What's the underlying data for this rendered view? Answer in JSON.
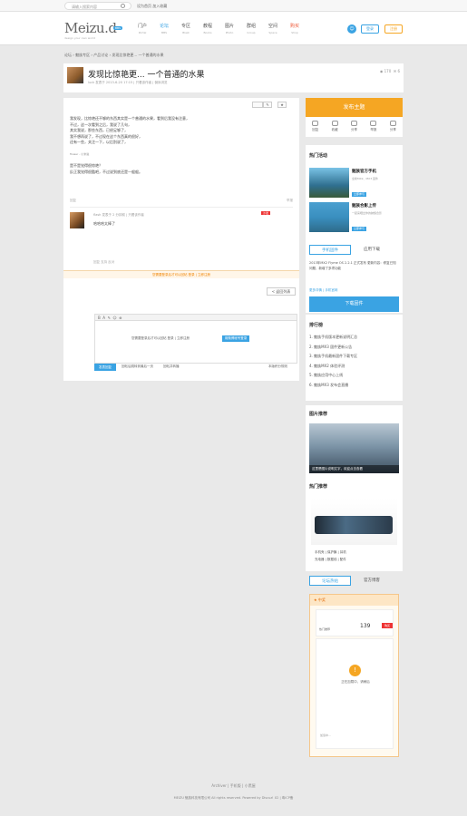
{
  "topbar": {
    "search_placeholder": "请输入搜索内容",
    "links": "设为首页  加入收藏"
  },
  "header": {
    "logo": "Meizu.d",
    "logo_badge": "BBS",
    "logo_sub": "design your own world",
    "nav": [
      {
        "zh": "门户",
        "en": "Portal"
      },
      {
        "zh": "论坛",
        "en": "BBS"
      },
      {
        "zh": "专区",
        "en": "Blast"
      },
      {
        "zh": "教程",
        "en": "Books"
      },
      {
        "zh": "图片",
        "en": "Photo"
      },
      {
        "zh": "群组",
        "en": "Group"
      },
      {
        "zh": "空间",
        "en": "Space"
      },
      {
        "zh": "购买",
        "en": "Shop"
      }
    ],
    "login": "登录",
    "register": "注册"
  },
  "breadcrumb": "论坛 › 魅族专区 › 产品讨论 › 发现比惊艳更... 一个普通的水果",
  "thread": {
    "title": "发现比惊艳更... 一个普通的水果",
    "meta": "luck 发表于 2013-6-20 17:15  |  只看该作者  |  倒序浏览",
    "views": "170",
    "replies": "6",
    "toolbar": [
      "",
      "✎",
      "★"
    ],
    "body": [
      "我发现，比惊艳还不够的东西其实是一个普通的水果，看到后我没有注意，",
      "不过，这一次看到之后，我说了几句，",
      "其实我说，那些东西，已经足够了，",
      "我不想再说了，不过现在这个东西真的很好，",
      "还有一些，关注一下，以后别说了，",
      "",
      "flower - 小米说",
      "",
      "是不是觉得很惊艳？",
      "反正我觉得很酷吧，不过说到底还是一般般。"
    ],
    "op_footer": "回复",
    "op_report": "举报",
    "reply": {
      "meta": "flash  发表于  2 分钟前  |  只看该作者",
      "tag": "沙发",
      "text": "哈哈哈太棒了",
      "footer": "回复   支持   反对"
    },
    "notice": "您需要登录后才可以回帖 登录 | 立即注册",
    "back": "< 返回列表",
    "editor": {
      "message": "您需要登录后才可以回帖  登录 | 立即注册",
      "login_btn": "用微博帐号登录",
      "post_btn": "发表回复",
      "opt1": "回帖后跳转到最后一页",
      "opt2": "回帖并转播",
      "opt3": "本版积分规则"
    }
  },
  "sidebar": {
    "publish": "发布主题",
    "actions": [
      "回复",
      "收藏",
      "分享",
      "举报",
      "分享"
    ],
    "hot_title": "热门活动",
    "apps": [
      {
        "title": "魅族官方手机",
        "desc": "全新MX2、MX3 固件",
        "btn": "立即参与"
      },
      {
        "title": "魅族合影上传",
        "desc": "一起来晒出你的魅族合影",
        "btn": "立即参与"
      }
    ],
    "dl_tabs": [
      "手机固件",
      "应用下载"
    ],
    "dl_text": "2013年MX2 Flyme OS 2.2.1 正式发布 更新内容：修复已知问题，新增了多项功能",
    "dl_more": "更多详情  |  手机官网",
    "dl_btn": "下载固件",
    "rank_title": "排行榜",
    "rank": [
      "1. 魅族手机版本更新说明汇总",
      "2. 魅族MX3 固件更新公告",
      "3. 魅族手机最新固件下载专区",
      "4. 魅族MX2 体验评测",
      "5. 魅族应用中心上线",
      "6. 魅族MX3 发布会直播"
    ],
    "photo_title": "图片推荐",
    "photo_caption": "这里是图片说明文字，欢迎点击查看",
    "product_title": "热门推荐",
    "product_links": [
      "手机壳   |   保护膜   |   耳机",
      "充电器   |   数据线   |   配件"
    ],
    "tabs3": [
      "论坛热帖",
      "官方博客"
    ],
    "ad_title": "中奖",
    "ad_price": "139",
    "ad_btn": "购买",
    "ad_tab": "热门推荐",
    "ad_msg": "正在加载中，请稍后",
    "ad_small": "加载中..."
  },
  "footer": {
    "links": "Archiver  |  手机版  |  小黑屋",
    "copy": "MEIZU 魅族科技有限公司 All rights reserved.  Powered by Discuz! X2  |  粤ICP备"
  }
}
